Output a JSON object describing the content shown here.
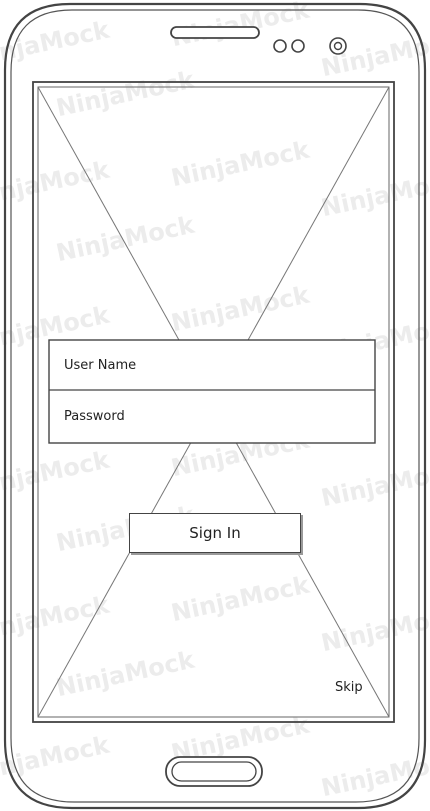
{
  "watermark": {
    "text": "NinjaMock"
  },
  "login_form": {
    "username_placeholder": "User Name",
    "password_placeholder": "Password"
  },
  "actions": {
    "sign_in_label": "Sign In",
    "skip_label": "Skip"
  },
  "colors": {
    "outline": "#444444",
    "watermark": "#ececec",
    "background": "#ffffff"
  }
}
